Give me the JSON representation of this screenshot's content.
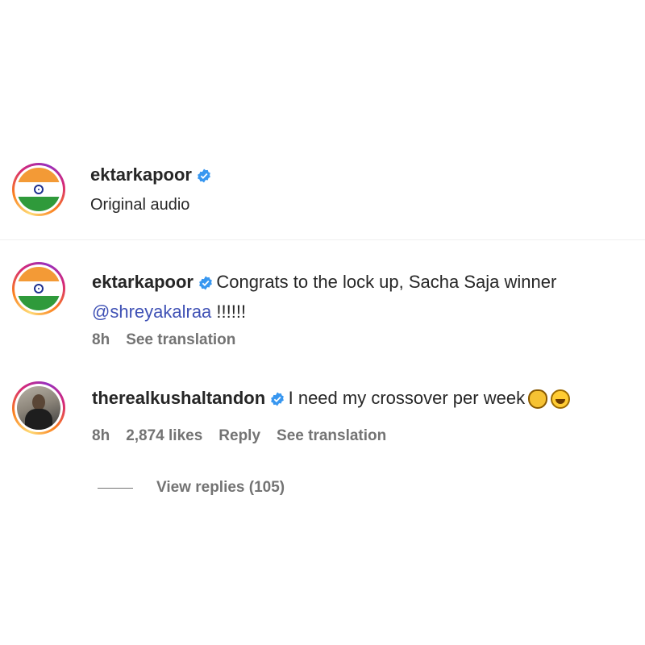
{
  "header": {
    "username": "ektarkapoor",
    "subtitle": "Original audio"
  },
  "comments": [
    {
      "username": "ektarkapoor",
      "text": "Congrats to the lock up, Sacha Saja winner",
      "mention": "@shreyakalraa",
      "suffix": " !!!!!!",
      "time": "8h",
      "see_translation": "See translation"
    },
    {
      "username": "therealkushaltandon",
      "text": "I need my crossover per week",
      "emojis": [
        "clapping-hands-emoji",
        "laughing-emoji"
      ],
      "time": "8h",
      "likes": "2,874 likes",
      "reply": "Reply",
      "see_translation": "See translation",
      "view_replies": "View replies (105)"
    }
  ],
  "colors": {
    "verified": "#3897f0",
    "mention": "#3f51b5",
    "meta": "#737373"
  }
}
